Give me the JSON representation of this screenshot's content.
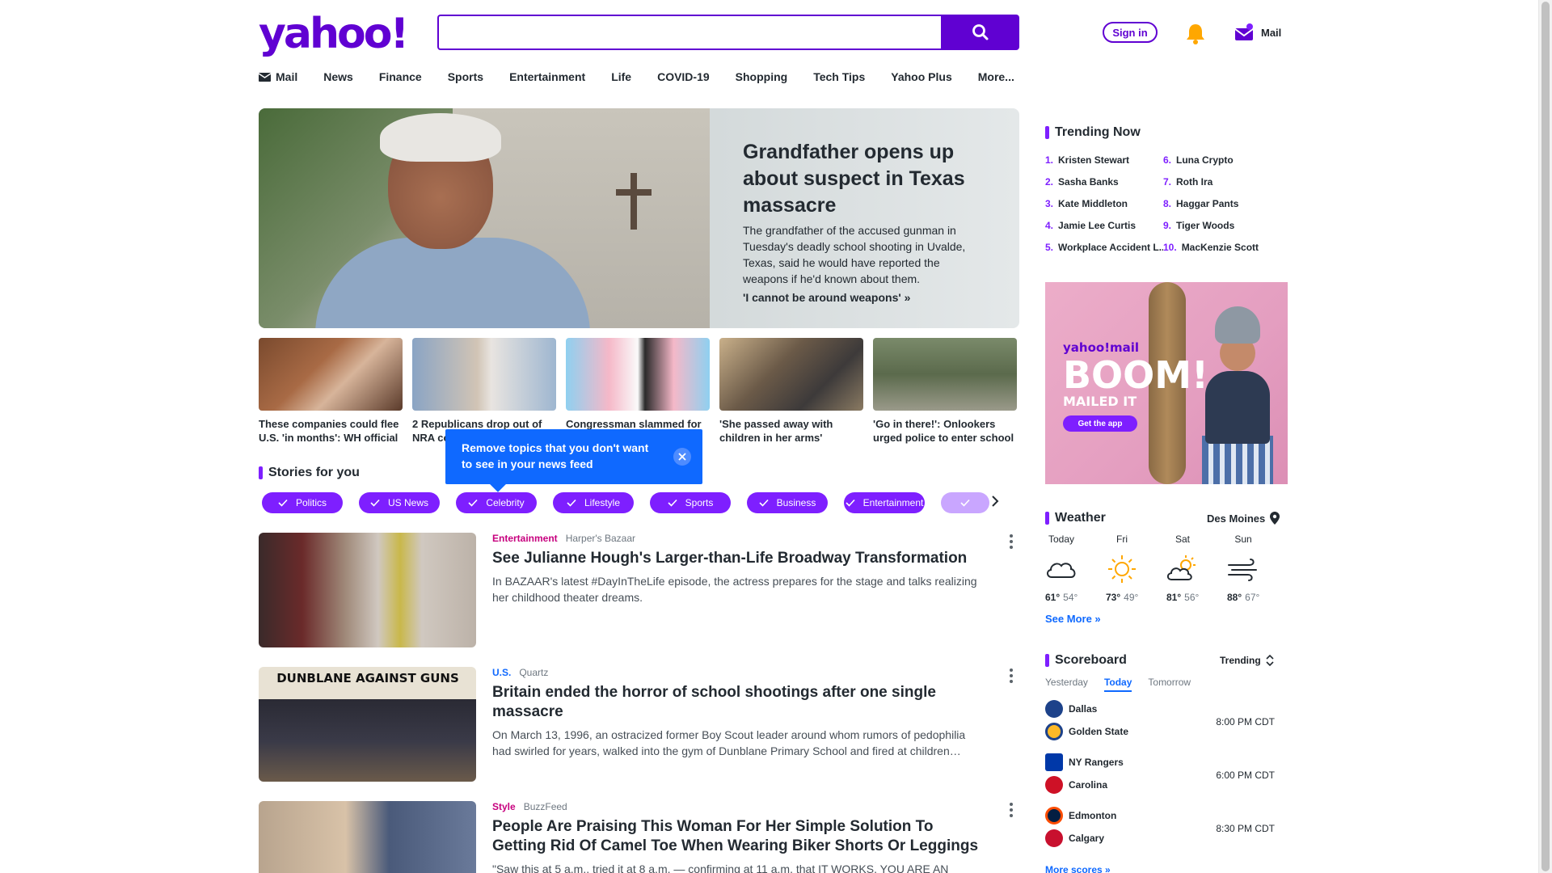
{
  "header": {
    "logo": "yahoo!",
    "search_placeholder": "",
    "signin_label": "Sign in",
    "mail_label": "Mail"
  },
  "nav": [
    {
      "label": "Mail",
      "icon": "mail-icon"
    },
    {
      "label": "News"
    },
    {
      "label": "Finance"
    },
    {
      "label": "Sports"
    },
    {
      "label": "Entertainment"
    },
    {
      "label": "Life"
    },
    {
      "label": "COVID-19"
    },
    {
      "label": "Shopping"
    },
    {
      "label": "Tech Tips"
    },
    {
      "label": "Yahoo Plus"
    },
    {
      "label": "More..."
    }
  ],
  "hero": {
    "title": "Grandfather opens up about suspect in Texas massacre",
    "desc": "The grandfather of the accused gunman in Tuesday's deadly school shooting in Uvalde, Texas, said he would have reported the weapons if he'd known about them.",
    "link": "'I cannot be around weapons' »"
  },
  "thumbs": [
    {
      "title": "These companies could flee U.S. 'in months': WH official"
    },
    {
      "title": "2 Republicans drop out of NRA convention"
    },
    {
      "title": "Congressman slammed for"
    },
    {
      "title": "'She passed away with children in her arms'"
    },
    {
      "title": "'Go in there!': Onlookers urged police to enter school"
    }
  ],
  "tooltip": {
    "text": "Remove topics that you don't want to see in your news feed"
  },
  "stories_header": "Stories for you",
  "chips": [
    "Politics",
    "US News",
    "Celebrity",
    "Lifestyle",
    "Sports",
    "Business",
    "Entertainment",
    ""
  ],
  "stories": [
    {
      "category": "Entertainment",
      "category_color": "#c7007e",
      "source": "Harper's Bazaar",
      "title": "See Julianne Hough's Larger-than-Life Broadway Transformation",
      "desc": "In BAZAAR's latest #DayInTheLife episode, the actress prepares for the stage and talks realizing her childhood theater dreams."
    },
    {
      "category": "U.S.",
      "category_color": "#0f69ff",
      "source": "Quartz",
      "title": "Britain ended the horror of school shootings after one single massacre",
      "desc": "On March 13, 1996, an ostracized former Boy Scout leader around whom rumors of pedophilia had swirled for years, walked into the gym of Dunblane Primary School and fired at children…"
    },
    {
      "category": "Style",
      "category_color": "#c7007e",
      "source": "BuzzFeed",
      "title": "People Are Praising This Woman For Her Simple Solution To Getting Rid Of Camel Toe When Wearing Biker Shorts Or Leggings",
      "desc": "\"Saw this at 5 a.m., tried it at 8 a.m. — confirming at 11 a.m. that IT WORKS. YOU ARE AN"
    }
  ],
  "story_images": {
    "banner_text": "DUNBLANE AGAINST GUNS"
  },
  "trending": {
    "title": "Trending Now",
    "items": [
      {
        "num": "1.",
        "label": "Kristen Stewart"
      },
      {
        "num": "6.",
        "label": "Luna Crypto"
      },
      {
        "num": "2.",
        "label": "Sasha Banks"
      },
      {
        "num": "7.",
        "label": "Roth Ira"
      },
      {
        "num": "3.",
        "label": "Kate Middleton"
      },
      {
        "num": "8.",
        "label": "Haggar Pants"
      },
      {
        "num": "4.",
        "label": "Jamie Lee Curtis"
      },
      {
        "num": "9.",
        "label": "Tiger Woods"
      },
      {
        "num": "5.",
        "label": "Workplace Accident L..."
      },
      {
        "num": "10.",
        "label": "MacKenzie Scott"
      }
    ]
  },
  "ad": {
    "brand": "yahoo!mail",
    "headline": "BOOM!",
    "sub": "MAILED IT",
    "cta": "Get the app"
  },
  "weather": {
    "title": "Weather",
    "location": "Des Moines",
    "days": [
      {
        "name": "Today",
        "icon": "cloudy-icon",
        "hi": "61°",
        "lo": "54°"
      },
      {
        "name": "Fri",
        "icon": "sunny-icon",
        "hi": "73°",
        "lo": "49°"
      },
      {
        "name": "Sat",
        "icon": "partly-cloudy-icon",
        "hi": "81°",
        "lo": "56°"
      },
      {
        "name": "Sun",
        "icon": "windy-icon",
        "hi": "88°",
        "lo": "67°"
      }
    ],
    "see_more": "See More »"
  },
  "scoreboard": {
    "title": "Scoreboard",
    "filter": "Trending",
    "tabs": [
      "Yesterday",
      "Today",
      "Tomorrow"
    ],
    "games": [
      {
        "home": "Dallas",
        "home_color": "#1d428a",
        "away": "Golden State",
        "away_color": "#1d428a",
        "time": "8:00 PM CDT"
      },
      {
        "home": "NY Rangers",
        "home_color": "#0038a8",
        "away": "Carolina",
        "away_color": "#ce1126",
        "time": "6:00 PM CDT"
      },
      {
        "home": "Edmonton",
        "home_color": "#041e42",
        "away": "Calgary",
        "away_color": "#c8102e",
        "time": "8:30 PM CDT"
      }
    ],
    "more": "More scores »"
  },
  "colors": {
    "brand": "#6001d2",
    "accent": "#7e1fff",
    "link": "#0f69ff",
    "tooltip": "#0f69ff"
  }
}
